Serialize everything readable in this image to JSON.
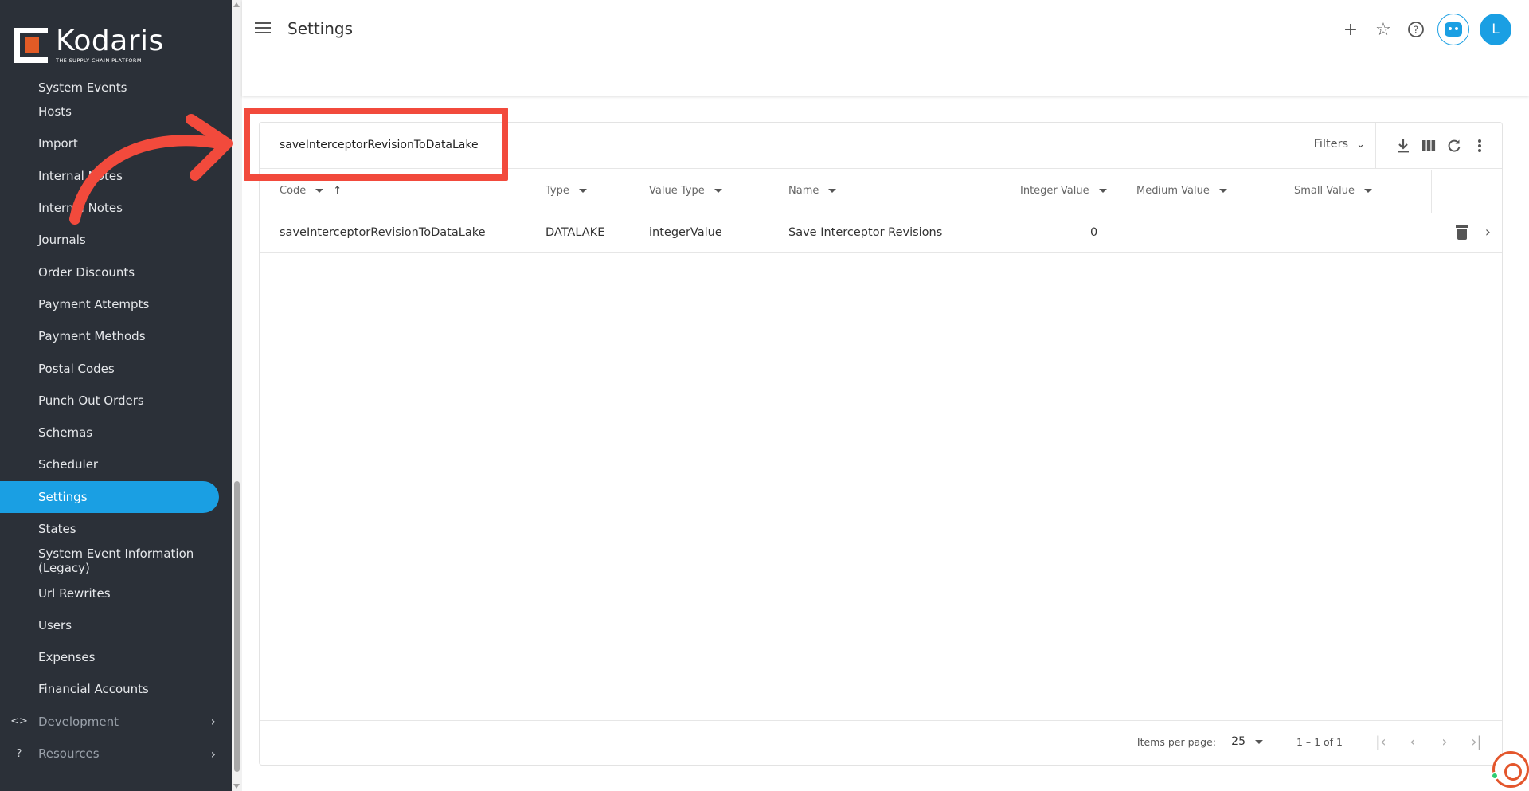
{
  "brand": {
    "name": "Kodaris",
    "tagline": "THE SUPPLY CHAIN PLATFORM",
    "accent_color": "#1a9fe3",
    "logo_color": "#e25b26"
  },
  "sidebar": {
    "items": [
      {
        "label": "System Events"
      },
      {
        "label": "Hosts"
      },
      {
        "label": "Import"
      },
      {
        "label": "Internal Notes"
      },
      {
        "label": "Internal Notes"
      },
      {
        "label": "Journals"
      },
      {
        "label": "Order Discounts"
      },
      {
        "label": "Payment Attempts"
      },
      {
        "label": "Payment Methods"
      },
      {
        "label": "Postal Codes"
      },
      {
        "label": "Punch Out Orders"
      },
      {
        "label": "Schemas"
      },
      {
        "label": "Scheduler"
      },
      {
        "label": "Settings",
        "active": true
      },
      {
        "label": "States"
      },
      {
        "label": "System Event Information (Legacy)"
      },
      {
        "label": "Url Rewrites"
      },
      {
        "label": "Users"
      },
      {
        "label": "Expenses"
      },
      {
        "label": "Financial Accounts"
      }
    ],
    "groups": [
      {
        "label": "Development",
        "icon": "code-icon",
        "glyph": "<>"
      },
      {
        "label": "Resources",
        "icon": "help-circle-icon",
        "glyph": "?"
      }
    ]
  },
  "header": {
    "title": "Settings",
    "avatar_initial": "L",
    "icons": [
      "plus-icon",
      "star-icon",
      "help-icon",
      "robot-icon"
    ]
  },
  "toolbar": {
    "search_value": "saveInterceptorRevisionToDataLake",
    "filters_label": "Filters",
    "icons": [
      "download-icon",
      "columns-icon",
      "refresh-icon",
      "more-vert-icon"
    ]
  },
  "table": {
    "columns": [
      "Code",
      "Type",
      "Value Type",
      "Name",
      "Integer Value",
      "Medium Value",
      "Small Value"
    ],
    "rows": [
      {
        "code": "saveInterceptorRevisionToDataLake",
        "type": "DATALAKE",
        "value_type": "integerValue",
        "name": "Save Interceptor Revisions",
        "integer_value": "0",
        "medium_value": "",
        "small_value": ""
      }
    ]
  },
  "pagination": {
    "items_per_page_label": "Items per page:",
    "items_per_page": "25",
    "range": "1 – 1 of 1"
  },
  "annotation": {
    "highlight_color": "#f24a3c"
  }
}
